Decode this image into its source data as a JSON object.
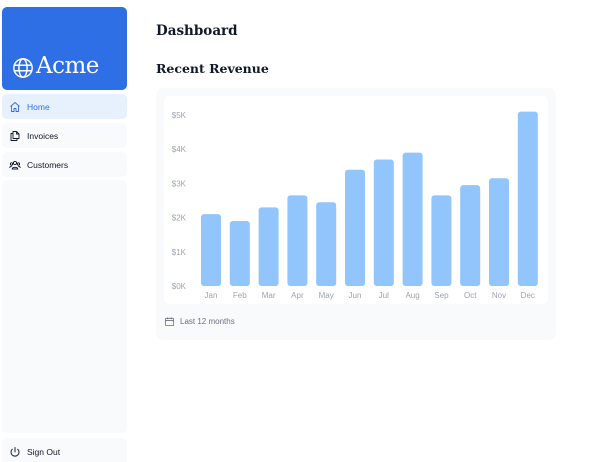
{
  "sidebar": {
    "logo_text": "Acme",
    "items": [
      {
        "label": "Home",
        "icon": "home-icon",
        "active": true
      },
      {
        "label": "Invoices",
        "icon": "document-duplicate-icon",
        "active": false
      },
      {
        "label": "Customers",
        "icon": "user-group-icon",
        "active": false
      }
    ],
    "sign_out_label": "Sign Out"
  },
  "main": {
    "title": "Dashboard",
    "section_title": "Recent Revenue",
    "footer_label": "Last 12 months"
  },
  "colors": {
    "brand": "#2f6fe6",
    "bar": "#93c5fd",
    "active_bg": "#e6f1fd"
  },
  "chart_data": {
    "type": "bar",
    "categories": [
      "Jan",
      "Feb",
      "Mar",
      "Apr",
      "May",
      "Jun",
      "Jul",
      "Aug",
      "Sep",
      "Oct",
      "Nov",
      "Dec"
    ],
    "values": [
      2100,
      1900,
      2300,
      2650,
      2450,
      3400,
      3700,
      3900,
      2650,
      2950,
      3150,
      5100
    ],
    "y_ticks": [
      "$5K",
      "$4K",
      "$3K",
      "$2K",
      "$1K",
      "$0K"
    ],
    "ylim": [
      0,
      5000
    ],
    "grid": false
  }
}
